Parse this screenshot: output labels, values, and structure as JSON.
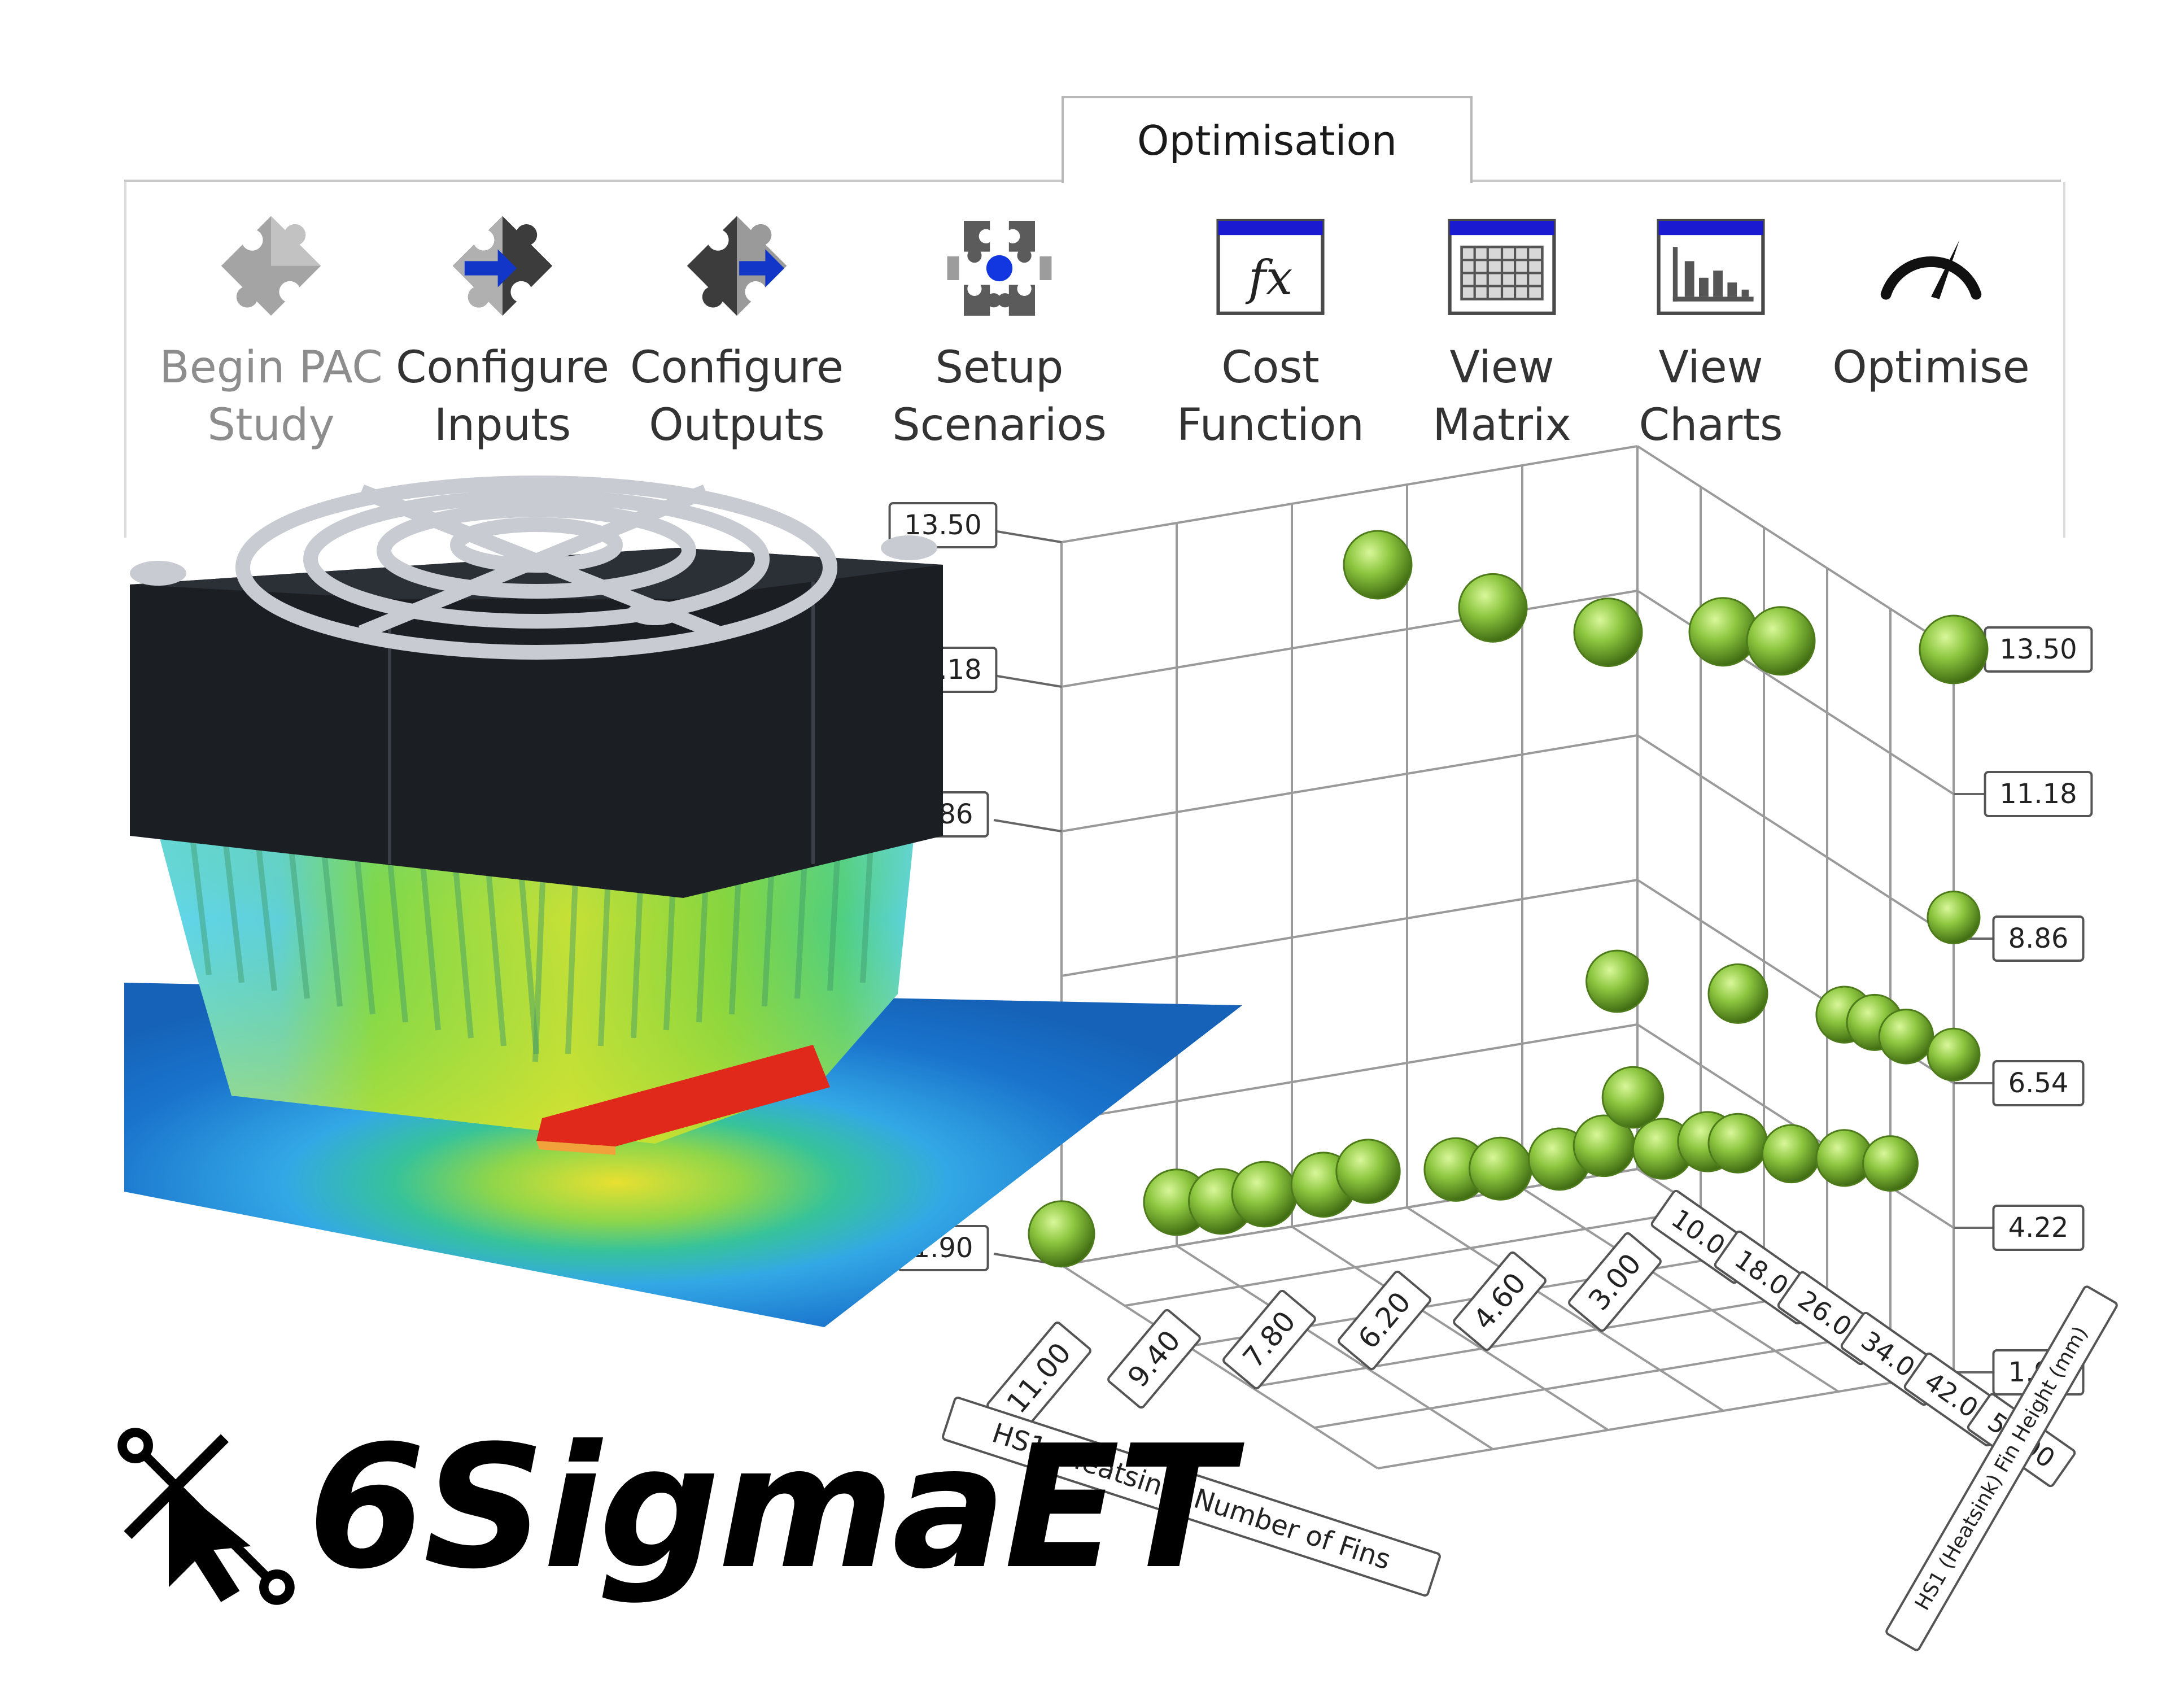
{
  "ribbon": {
    "tab_label": "Optimisation",
    "buttons": [
      {
        "id": "begin-pac-study",
        "label": "Begin PAC\nStudy",
        "icon": "puzzle-icon",
        "enabled": false
      },
      {
        "id": "configure-inputs",
        "label": "Configure\nInputs",
        "icon": "puzzle-input-arrow-icon",
        "enabled": true
      },
      {
        "id": "configure-outputs",
        "label": "Configure\nOutputs",
        "icon": "puzzle-output-arrow-icon",
        "enabled": true
      },
      {
        "id": "setup-scenarios",
        "label": "Setup\nScenarios",
        "icon": "puzzle-scenarios-icon",
        "enabled": true
      },
      {
        "id": "cost-function",
        "label": "Cost\nFunction",
        "icon": "fx-window-icon",
        "enabled": true
      },
      {
        "id": "view-matrix",
        "label": "View\nMatrix",
        "icon": "matrix-window-icon",
        "enabled": true
      },
      {
        "id": "view-charts",
        "label": "View\nCharts",
        "icon": "bar-chart-window-icon",
        "enabled": true
      },
      {
        "id": "optimise",
        "label": "Optimise",
        "icon": "gauge-icon",
        "enabled": true
      }
    ]
  },
  "chart_data": {
    "type": "scatter",
    "dimensions": "3d",
    "xlabel": "HS1 (Heatsink) Number of Fins",
    "zlabel": "HS1 (Heatsink) Fin Height (mm)",
    "ylabel": "",
    "x_ticks": [
      "11.00",
      "9.40",
      "7.80",
      "6.20",
      "4.60",
      "3.00"
    ],
    "z_ticks": [
      "10.00",
      "18.00",
      "26.00",
      "34.00",
      "42.00",
      "50.00"
    ],
    "y_ticks_left": [
      "1.90",
      "8.86",
      "11.18",
      "13.50"
    ],
    "y_ticks_right": [
      "1.90",
      "4.22",
      "6.54",
      "8.86",
      "11.18",
      "13.50"
    ],
    "ylim": [
      1.9,
      13.5
    ],
    "marker_color": "#8cc63f",
    "points": [
      {
        "x": 11.0,
        "z": 10,
        "y": 2.4
      },
      {
        "x": 9.4,
        "z": 10,
        "y": 2.6
      },
      {
        "x": 9.0,
        "z": 12,
        "y": 2.7
      },
      {
        "x": 8.4,
        "z": 12,
        "y": 2.7
      },
      {
        "x": 7.8,
        "z": 14,
        "y": 2.9
      },
      {
        "x": 7.4,
        "z": 16,
        "y": 3.2
      },
      {
        "x": 6.4,
        "z": 18,
        "y": 3.2
      },
      {
        "x": 6.0,
        "z": 20,
        "y": 3.3
      },
      {
        "x": 5.4,
        "z": 22,
        "y": 3.5
      },
      {
        "x": 5.0,
        "z": 24,
        "y": 3.8
      },
      {
        "x": 4.6,
        "z": 24,
        "y": 4.5
      },
      {
        "x": 4.4,
        "z": 26,
        "y": 3.8
      },
      {
        "x": 4.0,
        "z": 28,
        "y": 4.0
      },
      {
        "x": 3.8,
        "z": 30,
        "y": 4.1
      },
      {
        "x": 3.5,
        "z": 34,
        "y": 4.2
      },
      {
        "x": 3.2,
        "z": 38,
        "y": 4.4
      },
      {
        "x": 3.0,
        "z": 42,
        "y": 4.6
      },
      {
        "x": 4.6,
        "z": 22,
        "y": 6.2
      },
      {
        "x": 3.8,
        "z": 30,
        "y": 6.5
      },
      {
        "x": 3.2,
        "z": 38,
        "y": 6.7
      },
      {
        "x": 3.0,
        "z": 40,
        "y": 6.7
      },
      {
        "x": 3.0,
        "z": 44,
        "y": 6.8
      },
      {
        "x": 3.0,
        "z": 50,
        "y": 7.0
      },
      {
        "x": 3.0,
        "z": 50,
        "y": 9.2
      },
      {
        "x": 11.0,
        "z": 50,
        "y": 16.4
      },
      {
        "x": 9.4,
        "z": 50,
        "y": 15.4
      },
      {
        "x": 7.8,
        "z": 50,
        "y": 14.7
      },
      {
        "x": 6.2,
        "z": 50,
        "y": 14.4
      },
      {
        "x": 5.4,
        "z": 50,
        "y": 14.1
      },
      {
        "x": 3.0,
        "z": 50,
        "y": 13.5
      }
    ]
  },
  "brand": {
    "logo_text": "6SigmaET",
    "logo_icon": "cursor-bisect-icon"
  },
  "render": {
    "heatsink_model": "heatsink-thermal-model",
    "colors": {
      "fan_housing": "#1b1e23",
      "fan_guard": "#c8cbd1",
      "board_blue": "#1166c0",
      "hot_red": "#e0291b",
      "warm_yellow": "#e4e427",
      "mid_green": "#56cc38",
      "cool_cyan": "#5fd3ef"
    }
  }
}
